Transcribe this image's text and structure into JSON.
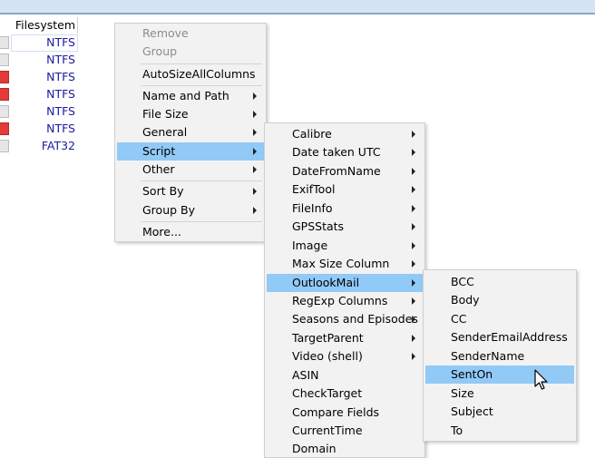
{
  "file_list": {
    "column_header": "Filesystem",
    "rows": [
      {
        "fs": "NTFS",
        "bar": "grey",
        "selected": true
      },
      {
        "fs": "NTFS",
        "bar": "grey"
      },
      {
        "fs": "NTFS",
        "bar": "red"
      },
      {
        "fs": "NTFS",
        "bar": "red"
      },
      {
        "fs": "NTFS",
        "bar": "grey"
      },
      {
        "fs": "NTFS",
        "bar": "red"
      },
      {
        "fs": "FAT32",
        "bar": "grey"
      }
    ]
  },
  "context_menu": {
    "items": [
      {
        "label": "Remove",
        "disabled": true
      },
      {
        "label": "Group",
        "disabled": true
      },
      {
        "label": "AutoSizeAllColumns"
      },
      {
        "label": "Name and Path",
        "submenu": true
      },
      {
        "label": "File Size",
        "submenu": true
      },
      {
        "label": "General",
        "submenu": true
      },
      {
        "label": "Script",
        "submenu": true,
        "highlighted": true
      },
      {
        "label": "Other",
        "submenu": true
      },
      {
        "label": "Sort By",
        "submenu": true
      },
      {
        "label": "Group By",
        "submenu": true
      },
      {
        "label": "More..."
      }
    ]
  },
  "script_submenu": {
    "items": [
      {
        "label": "Calibre",
        "submenu": true
      },
      {
        "label": "Date taken UTC",
        "submenu": true
      },
      {
        "label": "DateFromName",
        "submenu": true
      },
      {
        "label": "ExifTool",
        "submenu": true
      },
      {
        "label": "FileInfo",
        "submenu": true
      },
      {
        "label": "GPSStats",
        "submenu": true
      },
      {
        "label": "Image",
        "submenu": true
      },
      {
        "label": "Max Size Column",
        "submenu": true
      },
      {
        "label": "OutlookMail",
        "submenu": true,
        "highlighted": true
      },
      {
        "label": "RegExp Columns",
        "submenu": true
      },
      {
        "label": "Seasons and Episodes",
        "submenu": true
      },
      {
        "label": "TargetParent",
        "submenu": true
      },
      {
        "label": "Video (shell)",
        "submenu": true
      },
      {
        "label": "ASIN"
      },
      {
        "label": "CheckTarget"
      },
      {
        "label": "Compare Fields"
      },
      {
        "label": "CurrentTime"
      },
      {
        "label": "Domain"
      }
    ]
  },
  "outlookmail_submenu": {
    "items": [
      {
        "label": "BCC"
      },
      {
        "label": "Body"
      },
      {
        "label": "CC"
      },
      {
        "label": "SenderEmailAddress"
      },
      {
        "label": "SenderName"
      },
      {
        "label": "SentOn",
        "highlighted": true
      },
      {
        "label": "Size"
      },
      {
        "label": "Subject"
      },
      {
        "label": "To"
      }
    ]
  },
  "colors": {
    "highlight": "#91c9f7",
    "menu_bg": "#f2f2f2",
    "fs_text": "#1a1aa0",
    "bar_red": "#e43a3a"
  },
  "cursor_icon": "arrow-pointer-icon"
}
